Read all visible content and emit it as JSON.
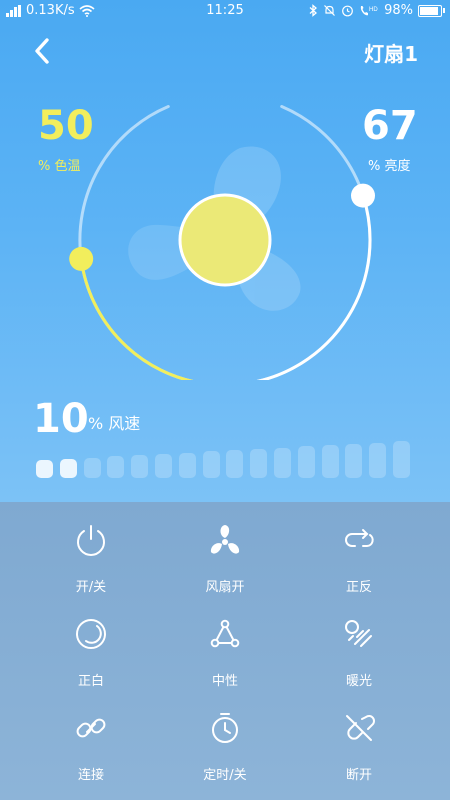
{
  "status_bar": {
    "signal": "4G",
    "network_speed": "0.13K/s",
    "time": "11:25",
    "hd_label": "HD",
    "battery": "98%",
    "battery_level": 0.98
  },
  "header": {
    "title": "灯扇1"
  },
  "color_temperature": {
    "value": "50",
    "label": "% 色温"
  },
  "brightness": {
    "value": "67",
    "label": "% 亮度"
  },
  "fan_speed": {
    "value": "10",
    "label": "% 风速",
    "level": 2,
    "total_levels": 16
  },
  "colors": {
    "accent_yellow": "#f2ee5c",
    "center_light": "#ebe977",
    "top_bg": "#4aa9f2",
    "bottom_bg": "#86b0d6"
  },
  "controls": [
    {
      "id": "power",
      "label": "开/关",
      "icon": "power-icon"
    },
    {
      "id": "fan",
      "label": "风扇开",
      "icon": "fan-icon"
    },
    {
      "id": "reverse",
      "label": "正反",
      "icon": "reverse-icon"
    },
    {
      "id": "white",
      "label": "正白",
      "icon": "moon-icon"
    },
    {
      "id": "neutral",
      "label": "中性",
      "icon": "triangle-nodes-icon"
    },
    {
      "id": "warm",
      "label": "暖光",
      "icon": "warm-light-icon"
    },
    {
      "id": "connect",
      "label": "连接",
      "icon": "link-icon"
    },
    {
      "id": "timer",
      "label": "定时/关",
      "icon": "timer-icon"
    },
    {
      "id": "disconnect",
      "label": "断开",
      "icon": "unlink-icon"
    }
  ]
}
